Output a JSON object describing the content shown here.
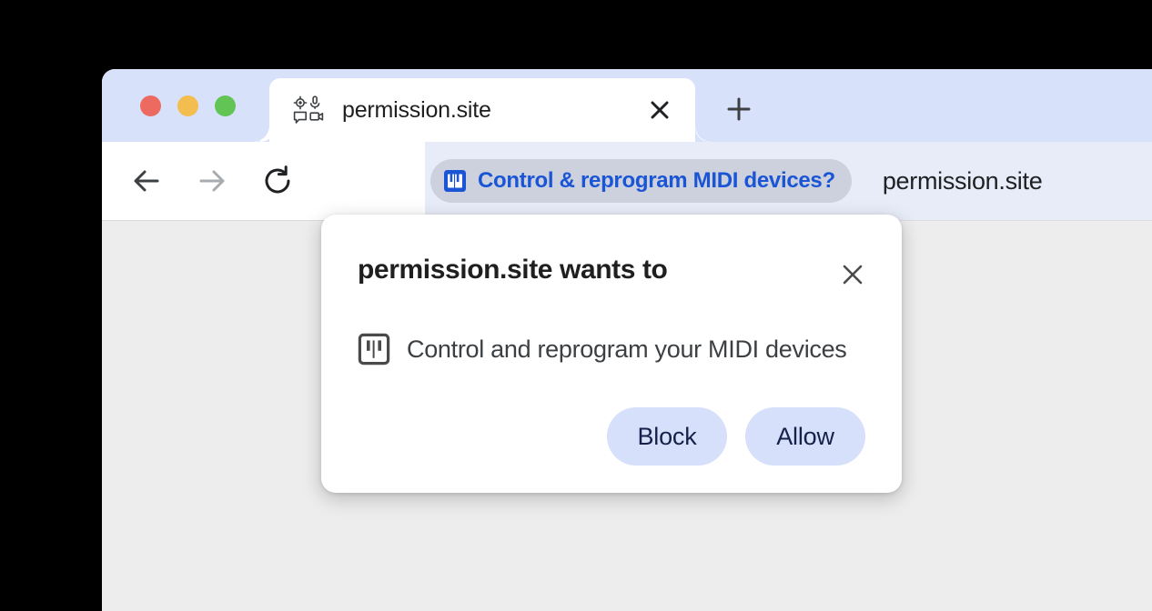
{
  "window": {
    "tab_strip": {
      "traffic_lights": [
        {
          "name": "close-window-button",
          "color": "#ec6a5f"
        },
        {
          "name": "minimize-window-button",
          "color": "#f4bd4f"
        },
        {
          "name": "maximize-window-button",
          "color": "#61c454"
        }
      ],
      "tab": {
        "favicon_name": "permission-site-favicon",
        "title": "permission.site",
        "close_label": "✕"
      },
      "new_tab_label": "+"
    },
    "toolbar": {
      "back_icon": "back-arrow-icon",
      "forward_icon": "forward-arrow-icon",
      "reload_icon": "reload-icon",
      "omnibox": {
        "chip_icon": "midi-piano-icon",
        "chip_label": "Control & reprogram MIDI devices?",
        "url": "permission.site"
      }
    }
  },
  "dialog": {
    "title": "permission.site wants to",
    "close_label": "✕",
    "body_icon": "midi-piano-icon",
    "body_text": "Control and reprogram your MIDI devices",
    "buttons": [
      {
        "label": "Block",
        "name": "block-button"
      },
      {
        "label": "Allow",
        "name": "allow-button"
      }
    ]
  },
  "colors": {
    "tab_strip": "#d7e1fa",
    "omnibox_bg": "#e8ecf8",
    "chip_bg": "#ccd1dd",
    "chip_text": "#1a55d6",
    "button_bg": "#d6e0fb",
    "button_text": "#16214a",
    "page_bg": "#ededed"
  }
}
